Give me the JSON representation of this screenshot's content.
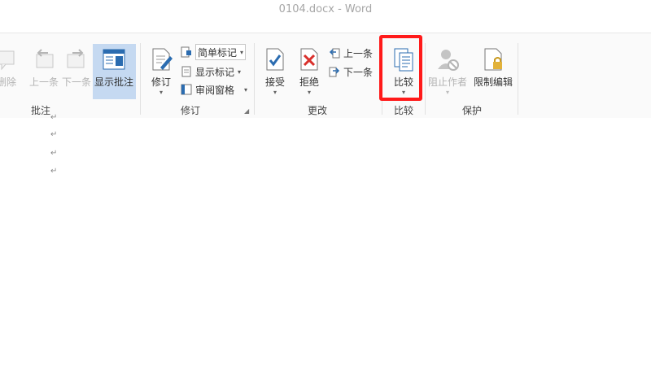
{
  "window": {
    "title": "0104.docx - Word"
  },
  "ribbon": {
    "groups": {
      "comments": {
        "label": "批注",
        "delete_label": "删除",
        "prev_label": "上一条",
        "next_label": "下一条",
        "show_comments_label": "显示批注"
      },
      "tracking": {
        "label": "修订",
        "track_changes_label": "修订",
        "markup_select_value": "简单标记",
        "show_markup_label": "显示标记",
        "reviewing_pane_label": "审阅窗格"
      },
      "changes": {
        "label": "更改",
        "accept_label": "接受",
        "reject_label": "拒绝",
        "prev_label": "上一条",
        "next_label": "下一条"
      },
      "compare": {
        "label": "比较",
        "compare_label": "比较"
      },
      "protect": {
        "label": "保护",
        "block_authors_label": "阻止作者",
        "restrict_editing_label": "限制编辑"
      }
    }
  },
  "colors": {
    "highlight": "#ff1a1a",
    "active_button": "#c5d9f1",
    "accent_blue": "#2b6cb0",
    "reject_red": "#d9302c"
  }
}
